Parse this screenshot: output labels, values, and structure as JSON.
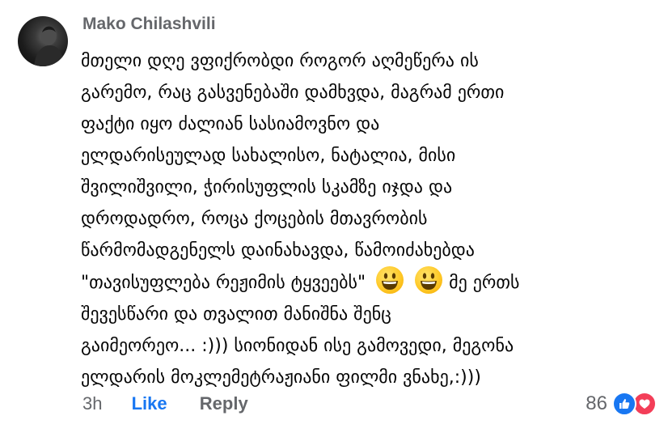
{
  "comment": {
    "author": "Mako Chilashvili",
    "text_part1": "მთელი დღე ვფიქრობდი როგორ აღმეწერა ის\nგარემო, რაც გასვენებაში დამხვდა, მაგრამ ერთი\nფაქტი იყო ძალიან სასიამოვნო და\nელდარისეულად სახალისო, ნატალია, მისი\nშვილიშვილი, ჭირისუფლის სკამზე იჯდა და\nდროდადრო, როცა ქოცების მთავრობის\nწარმომადგენელს დაინახავდა, წამოიძახებდა\n\"თავისუფლება რეჟიმის ტყვეებს\"",
    "text_part2": "მე ერთს\nშევესწარი და თვალით მანიშნა შენც\nგაიმეორეო...  :))) სიონიდან ისე გამოვედი, მეგონა\nელდარის  მოკლემეტრაჟიანი ფილმი ვნახე,:)))",
    "emojis": [
      "grinning-face",
      "grinning-face"
    ]
  },
  "footer": {
    "time": "3h",
    "like_label": "Like",
    "reply_label": "Reply"
  },
  "reactions": {
    "count": "86",
    "types": [
      "like-icon",
      "love-icon"
    ],
    "colors": {
      "like": "#1877f2",
      "love": "#f33e58"
    }
  },
  "colors": {
    "author": "#65676b",
    "text": "#050505",
    "link": "#1877f2",
    "muted": "#65676b"
  }
}
